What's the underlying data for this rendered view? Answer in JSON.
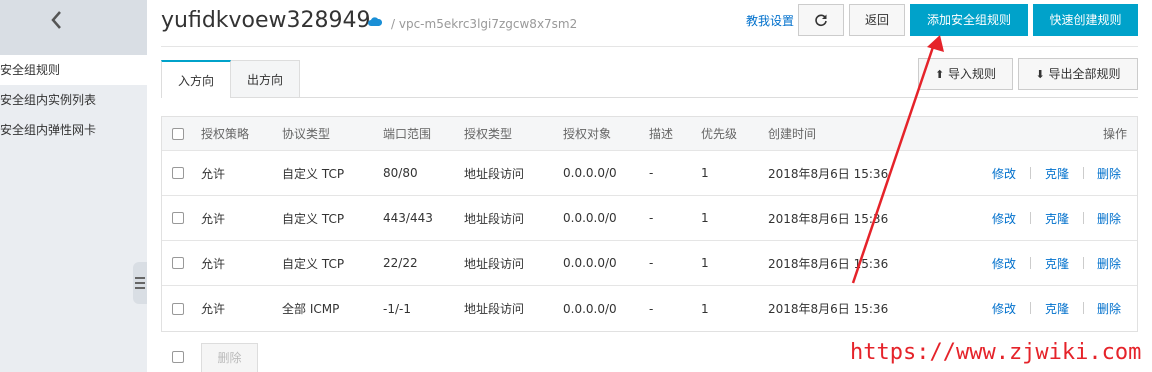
{
  "sidebar": {
    "items": [
      {
        "label": "安全组规则"
      },
      {
        "label": "安全组内实例列表"
      },
      {
        "label": "安全组内弹性网卡"
      }
    ]
  },
  "header": {
    "title": "yufidkvoew328949",
    "vpc": "/ vpc-m5ekrc3lgi7zgcw8x7sm2",
    "help_link": "教我设置",
    "back_label": "返回",
    "add_rule_label": "添加安全组规则",
    "quick_create_label": "快速创建规则"
  },
  "tabs": [
    {
      "label": "入方向"
    },
    {
      "label": "出方向"
    }
  ],
  "actions": {
    "import_label": "导入规则",
    "export_label": "导出全部规则"
  },
  "table": {
    "columns": [
      "授权策略",
      "协议类型",
      "端口范围",
      "授权类型",
      "授权对象",
      "描述",
      "优先级",
      "创建时间",
      "操作"
    ],
    "rows": [
      {
        "policy": "允许",
        "protocol": "自定义 TCP",
        "port": "80/80",
        "auth_type": "地址段访问",
        "object": "0.0.0.0/0",
        "desc": "-",
        "priority": "1",
        "created": "2018年8月6日 15:36"
      },
      {
        "policy": "允许",
        "protocol": "自定义 TCP",
        "port": "443/443",
        "auth_type": "地址段访问",
        "object": "0.0.0.0/0",
        "desc": "-",
        "priority": "1",
        "created": "2018年8月6日 15:36"
      },
      {
        "policy": "允许",
        "protocol": "自定义 TCP",
        "port": "22/22",
        "auth_type": "地址段访问",
        "object": "0.0.0.0/0",
        "desc": "-",
        "priority": "1",
        "created": "2018年8月6日 15:36"
      },
      {
        "policy": "允许",
        "protocol": "全部 ICMP",
        "port": "-1/-1",
        "auth_type": "地址段访问",
        "object": "0.0.0.0/0",
        "desc": "-",
        "priority": "1",
        "created": "2018年8月6日 15:36"
      }
    ],
    "ops": {
      "edit": "修改",
      "clone": "克隆",
      "delete": "删除"
    }
  },
  "bottom": {
    "delete_label": "删除"
  },
  "watermark": "https://www.zjwiki.com",
  "colors": {
    "primary": "#00a2ca",
    "link": "#0070cc",
    "annotation": "#e5232a"
  }
}
